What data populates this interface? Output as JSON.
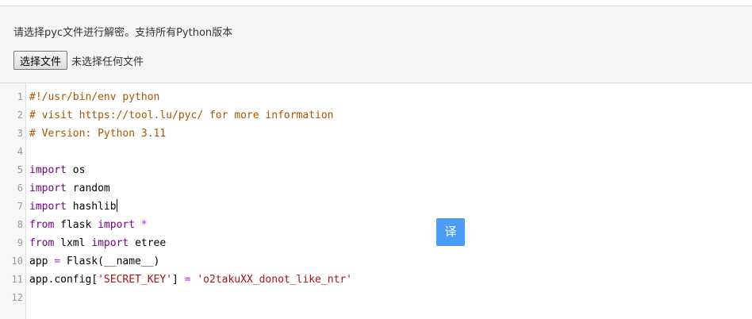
{
  "header": {
    "instruction": "请选择pyc文件进行解密。支持所有Python版本",
    "file_button_label": "选择文件",
    "file_status": "未选择任何文件"
  },
  "editor": {
    "lines": [
      {
        "number": "1",
        "tokens": [
          {
            "text": "#!/usr/bin/env python",
            "type": "comment"
          }
        ]
      },
      {
        "number": "2",
        "tokens": [
          {
            "text": "# visit https://tool.lu/pyc/ for more information",
            "type": "comment"
          }
        ]
      },
      {
        "number": "3",
        "tokens": [
          {
            "text": "# Version: Python 3.11",
            "type": "comment"
          }
        ]
      },
      {
        "number": "4",
        "tokens": []
      },
      {
        "number": "5",
        "tokens": [
          {
            "text": "import",
            "type": "keyword"
          },
          {
            "text": " os",
            "type": "plain"
          }
        ]
      },
      {
        "number": "6",
        "tokens": [
          {
            "text": "import",
            "type": "keyword"
          },
          {
            "text": " random",
            "type": "plain"
          }
        ]
      },
      {
        "number": "7",
        "tokens": [
          {
            "text": "import",
            "type": "keyword"
          },
          {
            "text": " hashlib",
            "type": "plain"
          }
        ],
        "cursor": true
      },
      {
        "number": "8",
        "tokens": [
          {
            "text": "from",
            "type": "keyword"
          },
          {
            "text": " flask ",
            "type": "plain"
          },
          {
            "text": "import",
            "type": "keyword"
          },
          {
            "text": " ",
            "type": "plain"
          },
          {
            "text": "*",
            "type": "operator"
          }
        ]
      },
      {
        "number": "9",
        "tokens": [
          {
            "text": "from",
            "type": "keyword"
          },
          {
            "text": " lxml ",
            "type": "plain"
          },
          {
            "text": "import",
            "type": "keyword"
          },
          {
            "text": " etree",
            "type": "plain"
          }
        ]
      },
      {
        "number": "10",
        "tokens": [
          {
            "text": "app ",
            "type": "plain"
          },
          {
            "text": "=",
            "type": "operator"
          },
          {
            "text": " Flask(__name__)",
            "type": "plain"
          }
        ]
      },
      {
        "number": "11",
        "tokens": [
          {
            "text": "app.config[",
            "type": "plain"
          },
          {
            "text": "'SECRET_KEY'",
            "type": "string"
          },
          {
            "text": "] ",
            "type": "plain"
          },
          {
            "text": "=",
            "type": "operator"
          },
          {
            "text": " ",
            "type": "plain"
          },
          {
            "text": "'o2takuXX_donot_like_ntr'",
            "type": "string"
          }
        ]
      },
      {
        "number": "12",
        "tokens": []
      }
    ]
  },
  "translate_button": {
    "label": "译",
    "color": "#4b9cf7"
  },
  "colors": {
    "comment": "#aa5500",
    "keyword": "#770088",
    "operator": "#aa22ff",
    "string": "#aa1111",
    "gutter_number": "#999999"
  }
}
